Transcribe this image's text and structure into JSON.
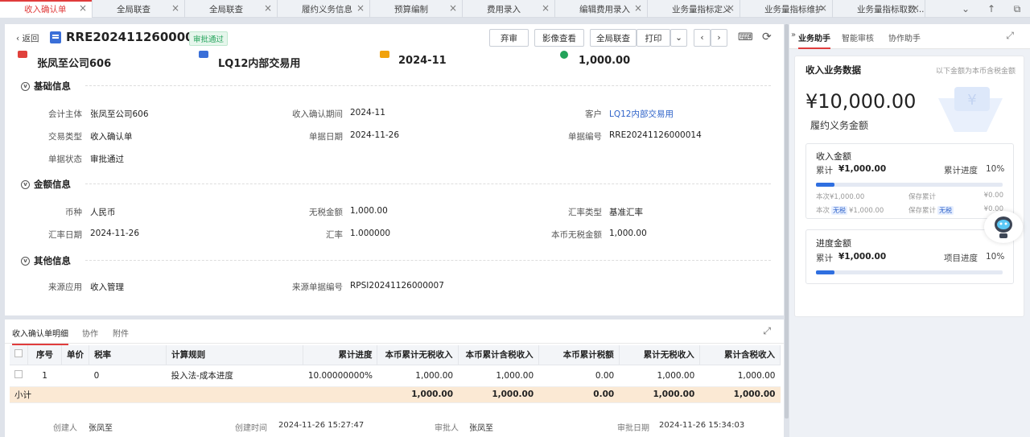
{
  "tabs": [
    {
      "label": "收入确认单"
    },
    {
      "label": "全局联查"
    },
    {
      "label": "全局联查"
    },
    {
      "label": "履约义务信息"
    },
    {
      "label": "预算编制"
    },
    {
      "label": "费用录入"
    },
    {
      "label": "编辑费用录入"
    },
    {
      "label": "业务量指标定义"
    },
    {
      "label": "业务量指标维护"
    },
    {
      "label": "业务量指标取数..."
    }
  ],
  "header": {
    "back": "返回",
    "doc_no": "RRE20241126000014",
    "status": "审批通过",
    "buttons": [
      "弃审",
      "影像查看",
      "全局联查",
      "打印"
    ]
  },
  "summary": {
    "company": "张凤至公司606",
    "customer": "LQ12内部交易用",
    "period": "2024-11",
    "amount": "1,000.00"
  },
  "sections": {
    "basic": {
      "title": "基础信息",
      "accounting_entity_label": "会计主体",
      "accounting_entity": "张凤至公司606",
      "period_label": "收入确认期间",
      "period": "2024-11",
      "customer_label": "客户",
      "customer": "LQ12内部交易用",
      "trade_type_label": "交易类型",
      "trade_type": "收入确认单",
      "doc_date_label": "单据日期",
      "doc_date": "2024-11-26",
      "doc_no_label": "单据编号",
      "doc_no": "RRE20241126000014",
      "doc_status_label": "单据状态",
      "doc_status": "审批通过"
    },
    "amount": {
      "title": "金额信息",
      "currency_label": "币种",
      "currency": "人民币",
      "untaxed_label": "无税金额",
      "untaxed": "1,000.00",
      "rate_type_label": "汇率类型",
      "rate_type": "基准汇率",
      "rate_date_label": "汇率日期",
      "rate_date": "2024-11-26",
      "rate_label": "汇率",
      "rate": "1.000000",
      "local_untaxed_label": "本币无税金额",
      "local_untaxed": "1,000.00"
    },
    "other": {
      "title": "其他信息",
      "source_app_label": "来源应用",
      "source_app": "收入管理",
      "source_doc_label": "来源单据编号",
      "source_doc": "RPSI20241126000007"
    }
  },
  "detail": {
    "tabs": [
      "收入确认单明细",
      "协作",
      "附件"
    ],
    "columns": [
      "序号",
      "单价",
      "税率",
      "计算规则",
      "累计进度",
      "本币累计无税收入",
      "本币累计含税收入",
      "本币累计税额",
      "累计无税收入",
      "累计含税收入"
    ],
    "row": [
      "1",
      "",
      "0",
      "投入法-成本进度",
      "10.00000000%",
      "1,000.00",
      "1,000.00",
      "0.00",
      "1,000.00",
      "1,000.00"
    ],
    "subtotal": [
      "小计",
      "",
      "",
      "",
      "",
      "1,000.00",
      "1,000.00",
      "0.00",
      "1,000.00",
      "1,000.00"
    ]
  },
  "footer": {
    "creator_label": "创建人",
    "creator": "张凤至",
    "create_time_label": "创建时间",
    "create_time": "2024-11-26 15:27:47",
    "approver_label": "审批人",
    "approver": "张凤至",
    "approve_date_label": "审批日期",
    "approve_date": "2024-11-26 15:34:03"
  },
  "panel": {
    "tabs": [
      "业务助手",
      "智能审核",
      "协作助手"
    ],
    "title": "收入业务数据",
    "note": "以下金额为本币含税金额",
    "big_amount": "¥10,000.00",
    "big_label": "履约义务金额",
    "income": {
      "title": "收入金额",
      "accum_label": "累计",
      "accum": "¥1,000.00",
      "progress_label": "累计进度",
      "progress": "10%",
      "progress_value": 0.1,
      "this_label": "本次",
      "this": "¥1,000.00",
      "save_label": "保存累计",
      "save": "¥0.00",
      "this2_label": "本次",
      "tag": "无税",
      "this2": "¥1,000.00",
      "save2_label": "保存累计",
      "tag2": "无税",
      "save2": "¥0.00"
    },
    "progress": {
      "title": "进度金额",
      "accum_label": "累计",
      "accum": "¥1,000.00",
      "progress_label": "项目进度",
      "progress": "10%",
      "progress_value": 0.1
    }
  },
  "colors": {
    "accent": "#e03c3c",
    "link": "#2f63c9",
    "success": "#23a35a",
    "bar": "#2f6fe0"
  }
}
